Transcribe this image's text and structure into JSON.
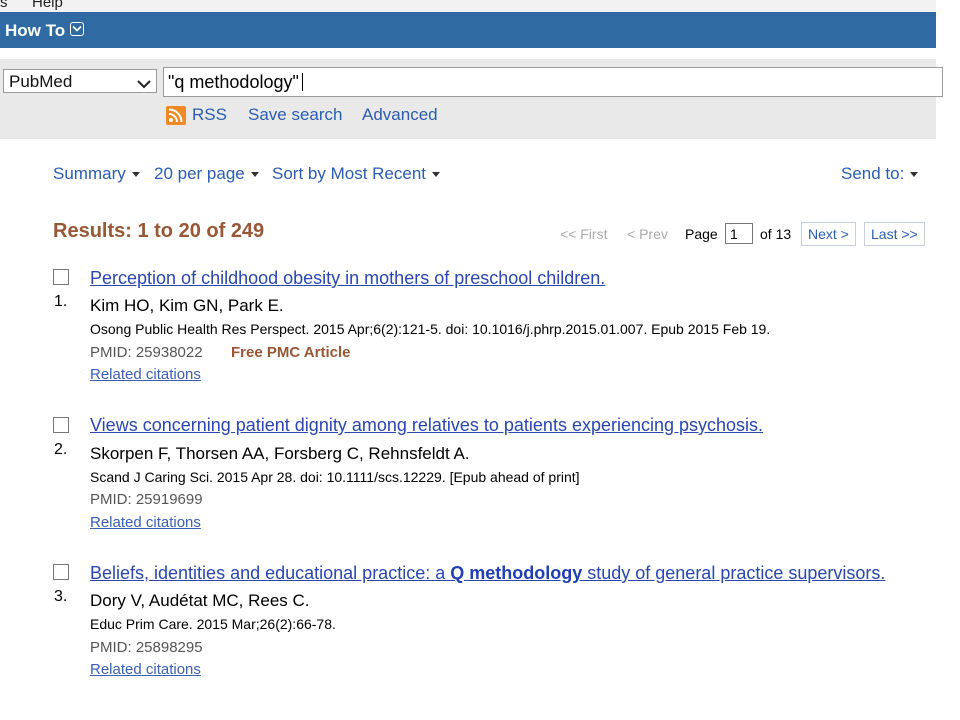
{
  "menu": {
    "left_fragment": "s",
    "help": "Help"
  },
  "howto": {
    "label": "How To"
  },
  "search": {
    "database": "PubMed",
    "query": "\"q methodology\"",
    "rss_label": "RSS",
    "save_search_label": "Save search",
    "advanced_label": "Advanced"
  },
  "toolbar": {
    "format": "Summary",
    "per_page": "20 per page",
    "sort": "Sort by Most Recent",
    "send_to": "Send to:"
  },
  "results": {
    "count_text": "Results: 1 to 20 of 249",
    "pager": {
      "first": "<< First",
      "prev": "< Prev",
      "page_label": "Page",
      "page_value": "1",
      "of_text": "of 13",
      "next": "Next >",
      "last": "Last >>"
    },
    "items": [
      {
        "number": "1.",
        "title": "Perception of childhood obesity in mothers of preschool children.",
        "authors": "Kim HO, Kim GN, Park E.",
        "citation": "Osong Public Health Res Perspect. 2015 Apr;6(2):121-5. doi: 10.1016/j.phrp.2015.01.007. Epub 2015 Feb 19.",
        "pmid": "PMID: 25938022",
        "free": "Free PMC Article",
        "related": "Related citations"
      },
      {
        "number": "2.",
        "title": "Views concerning patient dignity among relatives to patients experiencing psychosis.",
        "authors": "Skorpen F, Thorsen AA, Forsberg C, Rehnsfeldt A.",
        "citation": "Scand J Caring Sci. 2015 Apr 28. doi: 10.1111/scs.12229. [Epub ahead of print]",
        "pmid": "PMID: 25919699",
        "related": "Related citations"
      },
      {
        "number": "3.",
        "title_before": "Beliefs, identities and educational practice: a ",
        "title_bold": "Q methodology",
        "title_after": " study of general practice supervisors.",
        "authors": "Dory V, Audétat MC, Rees C.",
        "citation": "Educ Prim Care. 2015 Mar;26(2):66-78.",
        "pmid": "PMID: 25898295",
        "related": "Related citations"
      }
    ]
  }
}
